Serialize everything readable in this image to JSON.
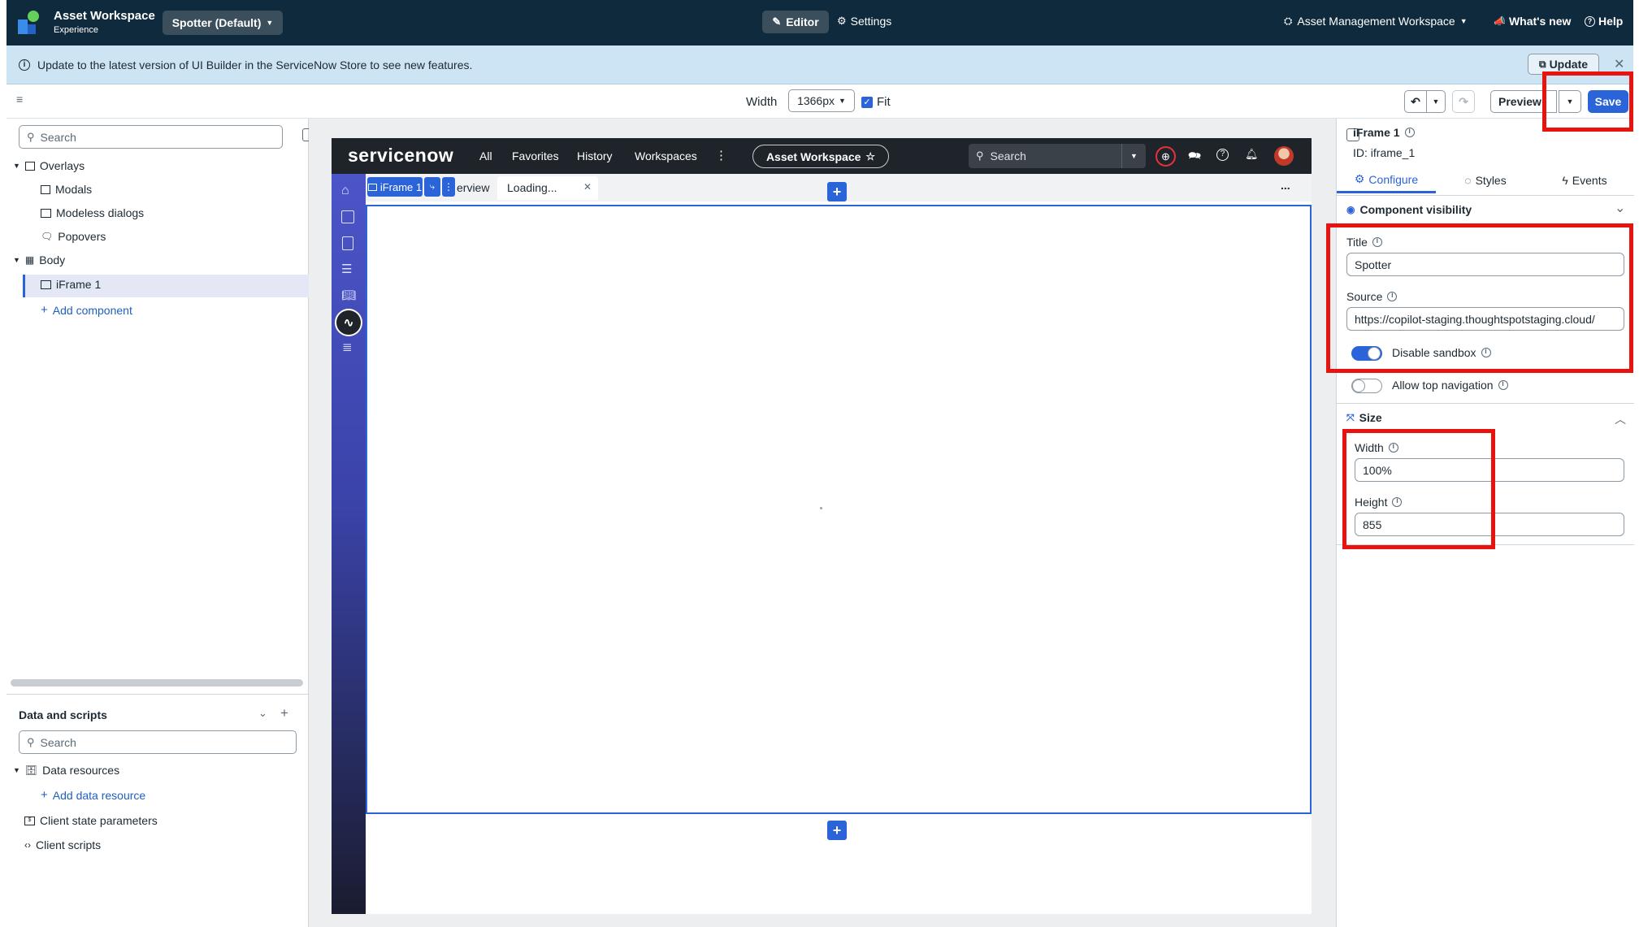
{
  "topbar": {
    "app_name": "Asset Workspace",
    "app_subtitle": "Experience",
    "variant_label": "Spotter (Default)",
    "editor_label": "Editor",
    "settings_label": "Settings",
    "workspace_label": "Asset Management Workspace",
    "whats_new_label": "What's new",
    "help_label": "Help"
  },
  "banner": {
    "message": "Update to the latest version of UI Builder in the ServiceNow Store to see new features.",
    "update_label": "Update"
  },
  "toolbar": {
    "width_label": "Width",
    "width_value": "1366px",
    "fit_label": "Fit",
    "fit_checked": true,
    "preview_label": "Preview",
    "save_label": "Save"
  },
  "left_panel": {
    "search_placeholder": "Search",
    "tree": {
      "overlays": "Overlays",
      "modals": "Modals",
      "modeless": "Modeless dialogs",
      "popovers": "Popovers",
      "body": "Body",
      "iframe": "iFrame 1",
      "add_component": "Add component"
    },
    "data_scripts": {
      "title": "Data and scripts",
      "search_placeholder": "Search",
      "data_resources": "Data resources",
      "add_data_resource": "Add data resource",
      "client_state": "Client state parameters",
      "client_scripts": "Client scripts"
    }
  },
  "app_preview": {
    "logo": "servicenow",
    "nav": [
      "All",
      "Favorites",
      "History",
      "Workspaces"
    ],
    "workspace_pill": "Asset Workspace",
    "search_placeholder": "Search",
    "tab_component": "iFrame 1",
    "tab_overview_fragment": "erview",
    "tab_loading": "Loading...",
    "more": "..."
  },
  "right_panel": {
    "component_name": "iFrame 1",
    "component_id": "ID: iframe_1",
    "tabs": [
      "Configure",
      "Styles",
      "Events"
    ],
    "section_visibility": "Component visibility",
    "title_label": "Title",
    "title_value": "Spotter",
    "source_label": "Source",
    "source_value": "https://copilot-staging.thoughtspotstaging.cloud/",
    "disable_sandbox_label": "Disable sandbox",
    "disable_sandbox_on": true,
    "allow_top_nav_label": "Allow top navigation",
    "allow_top_nav_on": false,
    "section_size": "Size",
    "width_label": "Width",
    "width_value": "100%",
    "height_label": "Height",
    "height_value": "855"
  },
  "colors": {
    "topbar_bg": "#0f2a3c",
    "banner_bg": "#cde4f4",
    "accent_blue": "#2b63d9",
    "highlight_red": "#e8130e"
  }
}
